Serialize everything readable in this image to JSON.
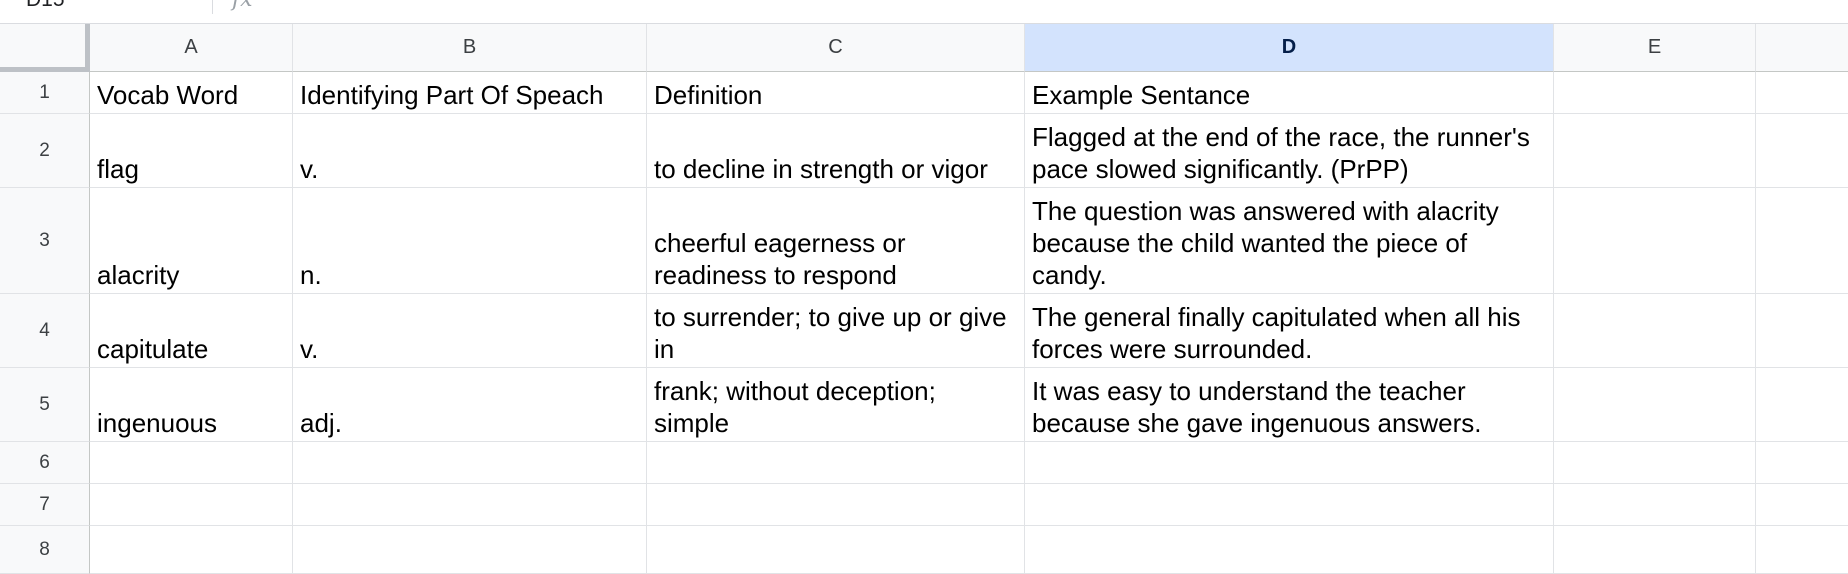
{
  "formula_bar": {
    "name_box": "D15",
    "fx_icon": "fx-icon"
  },
  "columns": [
    {
      "label": "A",
      "selected": false
    },
    {
      "label": "B",
      "selected": false
    },
    {
      "label": "C",
      "selected": false
    },
    {
      "label": "D",
      "selected": true
    },
    {
      "label": "E",
      "selected": false
    }
  ],
  "rows": [
    "1",
    "2",
    "3",
    "4",
    "5",
    "6",
    "7",
    "8"
  ],
  "cells": {
    "r1": {
      "a": "Vocab Word",
      "b": "Identifying Part Of Speach",
      "c": "Definition",
      "d": "Example Sentance"
    },
    "r2": {
      "a": "flag",
      "b": "v.",
      "c": "to decline in strength or vigor",
      "d": "Flagged at the end of the race, the runner's pace slowed significantly. (PrPP)"
    },
    "r3": {
      "a": "alacrity",
      "b": "n.",
      "c": "cheerful eagerness or readiness to respond",
      "d": "The question was answered with alacrity because the child wanted the piece of candy."
    },
    "r4": {
      "a": "capitulate",
      "b": "v.",
      "c": "to surrender; to give up or give in",
      "d": "The general finally capitulated when all his forces were surrounded."
    },
    "r5": {
      "a": "ingenuous",
      "b": "adj.",
      "c": "frank; without deception; simple",
      "d": "It was easy to understand the teacher because she gave ingenuous answers."
    }
  },
  "colors": {
    "header_bg": "#f8f9fa",
    "selected_header_bg": "#d3e3fd",
    "gridline": "#e1e3e6"
  }
}
